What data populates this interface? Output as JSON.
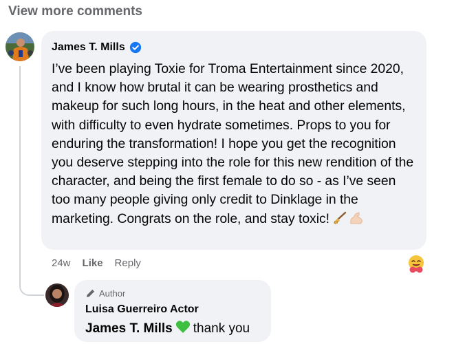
{
  "view_more_label": "View more comments",
  "comment": {
    "author": "James T. Mills",
    "verified": true,
    "text": "I’ve been playing Toxie for Troma Entertainment since 2020, and I know how brutal it can be wearing prosthetics and makeup for such long hours, in the heat and other elements, with difficulty to even hydrate sometimes. Props to you for enduring the transformation! I hope you get the recognition you deserve stepping into the role for this new rendition of the character, and being the first female to do so - as I’ve seen too many people giving only credit to Dinklage in the marketing. Congrats on the role, and stay toxic!",
    "emojis": [
      "broom-icon",
      "flexed-biceps-icon"
    ],
    "time": "24w",
    "like_label": "Like",
    "reply_label": "Reply",
    "reaction": "hugging-face-icon"
  },
  "reply": {
    "badge": "Author",
    "author": "Luisa Guerreiro Actor",
    "mention": "James T. Mills",
    "heart_color": "#3fbf3f",
    "text": "thank you"
  },
  "colors": {
    "bubble": "#f0f2f5",
    "secondary_text": "#65676b",
    "verified_blue": "#1877f2"
  }
}
